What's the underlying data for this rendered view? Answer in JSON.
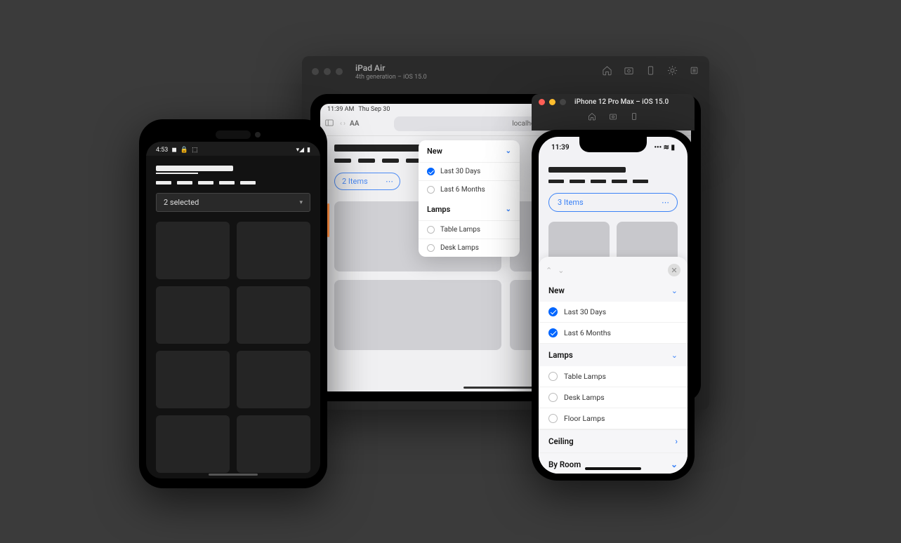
{
  "ipad": {
    "title": "iPad Air",
    "subtitle": "4th generation – iOS 15.0",
    "status": {
      "time": "11:39 AM",
      "date": "Thu Sep 30"
    },
    "safari": {
      "aa": "AA",
      "url": "localhost"
    },
    "filter_chip": "2 Items",
    "popover": {
      "section1": {
        "title": "New",
        "opt1": "Last 30 Days",
        "opt2": "Last 6 Months"
      },
      "section2": {
        "title": "Lamps",
        "opt1": "Table Lamps",
        "opt2": "Desk Lamps"
      }
    }
  },
  "android": {
    "status": {
      "time": "4:53"
    },
    "select": "2 selected"
  },
  "iphone": {
    "title": "iPhone 12 Pro Max – iOS 15.0",
    "status": {
      "time": "11:39"
    },
    "filter_chip": "3 Items",
    "sheet": {
      "section1": {
        "title": "New",
        "opt1": "Last 30 Days",
        "opt2": "Last 6 Months"
      },
      "section2": {
        "title": "Lamps",
        "opt1": "Table Lamps",
        "opt2": "Desk Lamps",
        "opt3": "Floor Lamps"
      },
      "section3": {
        "title": "Ceiling"
      },
      "section4": {
        "title": "By Room"
      }
    }
  }
}
